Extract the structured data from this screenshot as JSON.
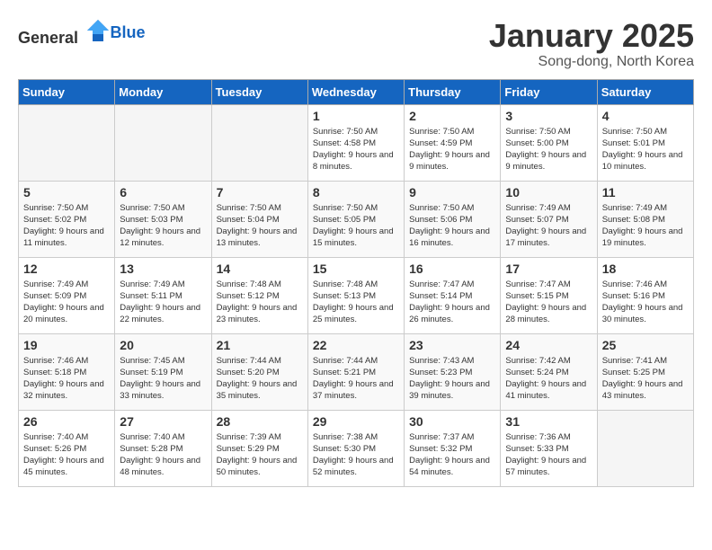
{
  "header": {
    "logo_general": "General",
    "logo_blue": "Blue",
    "title": "January 2025",
    "subtitle": "Song-dong, North Korea"
  },
  "weekdays": [
    "Sunday",
    "Monday",
    "Tuesday",
    "Wednesday",
    "Thursday",
    "Friday",
    "Saturday"
  ],
  "weeks": [
    [
      {
        "day": "",
        "empty": true
      },
      {
        "day": "",
        "empty": true
      },
      {
        "day": "",
        "empty": true
      },
      {
        "day": "1",
        "sunrise": "Sunrise: 7:50 AM",
        "sunset": "Sunset: 4:58 PM",
        "daylight": "Daylight: 9 hours and 8 minutes."
      },
      {
        "day": "2",
        "sunrise": "Sunrise: 7:50 AM",
        "sunset": "Sunset: 4:59 PM",
        "daylight": "Daylight: 9 hours and 9 minutes."
      },
      {
        "day": "3",
        "sunrise": "Sunrise: 7:50 AM",
        "sunset": "Sunset: 5:00 PM",
        "daylight": "Daylight: 9 hours and 9 minutes."
      },
      {
        "day": "4",
        "sunrise": "Sunrise: 7:50 AM",
        "sunset": "Sunset: 5:01 PM",
        "daylight": "Daylight: 9 hours and 10 minutes."
      }
    ],
    [
      {
        "day": "5",
        "sunrise": "Sunrise: 7:50 AM",
        "sunset": "Sunset: 5:02 PM",
        "daylight": "Daylight: 9 hours and 11 minutes."
      },
      {
        "day": "6",
        "sunrise": "Sunrise: 7:50 AM",
        "sunset": "Sunset: 5:03 PM",
        "daylight": "Daylight: 9 hours and 12 minutes."
      },
      {
        "day": "7",
        "sunrise": "Sunrise: 7:50 AM",
        "sunset": "Sunset: 5:04 PM",
        "daylight": "Daylight: 9 hours and 13 minutes."
      },
      {
        "day": "8",
        "sunrise": "Sunrise: 7:50 AM",
        "sunset": "Sunset: 5:05 PM",
        "daylight": "Daylight: 9 hours and 15 minutes."
      },
      {
        "day": "9",
        "sunrise": "Sunrise: 7:50 AM",
        "sunset": "Sunset: 5:06 PM",
        "daylight": "Daylight: 9 hours and 16 minutes."
      },
      {
        "day": "10",
        "sunrise": "Sunrise: 7:49 AM",
        "sunset": "Sunset: 5:07 PM",
        "daylight": "Daylight: 9 hours and 17 minutes."
      },
      {
        "day": "11",
        "sunrise": "Sunrise: 7:49 AM",
        "sunset": "Sunset: 5:08 PM",
        "daylight": "Daylight: 9 hours and 19 minutes."
      }
    ],
    [
      {
        "day": "12",
        "sunrise": "Sunrise: 7:49 AM",
        "sunset": "Sunset: 5:09 PM",
        "daylight": "Daylight: 9 hours and 20 minutes."
      },
      {
        "day": "13",
        "sunrise": "Sunrise: 7:49 AM",
        "sunset": "Sunset: 5:11 PM",
        "daylight": "Daylight: 9 hours and 22 minutes."
      },
      {
        "day": "14",
        "sunrise": "Sunrise: 7:48 AM",
        "sunset": "Sunset: 5:12 PM",
        "daylight": "Daylight: 9 hours and 23 minutes."
      },
      {
        "day": "15",
        "sunrise": "Sunrise: 7:48 AM",
        "sunset": "Sunset: 5:13 PM",
        "daylight": "Daylight: 9 hours and 25 minutes."
      },
      {
        "day": "16",
        "sunrise": "Sunrise: 7:47 AM",
        "sunset": "Sunset: 5:14 PM",
        "daylight": "Daylight: 9 hours and 26 minutes."
      },
      {
        "day": "17",
        "sunrise": "Sunrise: 7:47 AM",
        "sunset": "Sunset: 5:15 PM",
        "daylight": "Daylight: 9 hours and 28 minutes."
      },
      {
        "day": "18",
        "sunrise": "Sunrise: 7:46 AM",
        "sunset": "Sunset: 5:16 PM",
        "daylight": "Daylight: 9 hours and 30 minutes."
      }
    ],
    [
      {
        "day": "19",
        "sunrise": "Sunrise: 7:46 AM",
        "sunset": "Sunset: 5:18 PM",
        "daylight": "Daylight: 9 hours and 32 minutes."
      },
      {
        "day": "20",
        "sunrise": "Sunrise: 7:45 AM",
        "sunset": "Sunset: 5:19 PM",
        "daylight": "Daylight: 9 hours and 33 minutes."
      },
      {
        "day": "21",
        "sunrise": "Sunrise: 7:44 AM",
        "sunset": "Sunset: 5:20 PM",
        "daylight": "Daylight: 9 hours and 35 minutes."
      },
      {
        "day": "22",
        "sunrise": "Sunrise: 7:44 AM",
        "sunset": "Sunset: 5:21 PM",
        "daylight": "Daylight: 9 hours and 37 minutes."
      },
      {
        "day": "23",
        "sunrise": "Sunrise: 7:43 AM",
        "sunset": "Sunset: 5:23 PM",
        "daylight": "Daylight: 9 hours and 39 minutes."
      },
      {
        "day": "24",
        "sunrise": "Sunrise: 7:42 AM",
        "sunset": "Sunset: 5:24 PM",
        "daylight": "Daylight: 9 hours and 41 minutes."
      },
      {
        "day": "25",
        "sunrise": "Sunrise: 7:41 AM",
        "sunset": "Sunset: 5:25 PM",
        "daylight": "Daylight: 9 hours and 43 minutes."
      }
    ],
    [
      {
        "day": "26",
        "sunrise": "Sunrise: 7:40 AM",
        "sunset": "Sunset: 5:26 PM",
        "daylight": "Daylight: 9 hours and 45 minutes."
      },
      {
        "day": "27",
        "sunrise": "Sunrise: 7:40 AM",
        "sunset": "Sunset: 5:28 PM",
        "daylight": "Daylight: 9 hours and 48 minutes."
      },
      {
        "day": "28",
        "sunrise": "Sunrise: 7:39 AM",
        "sunset": "Sunset: 5:29 PM",
        "daylight": "Daylight: 9 hours and 50 minutes."
      },
      {
        "day": "29",
        "sunrise": "Sunrise: 7:38 AM",
        "sunset": "Sunset: 5:30 PM",
        "daylight": "Daylight: 9 hours and 52 minutes."
      },
      {
        "day": "30",
        "sunrise": "Sunrise: 7:37 AM",
        "sunset": "Sunset: 5:32 PM",
        "daylight": "Daylight: 9 hours and 54 minutes."
      },
      {
        "day": "31",
        "sunrise": "Sunrise: 7:36 AM",
        "sunset": "Sunset: 5:33 PM",
        "daylight": "Daylight: 9 hours and 57 minutes."
      },
      {
        "day": "",
        "empty": true
      }
    ]
  ]
}
